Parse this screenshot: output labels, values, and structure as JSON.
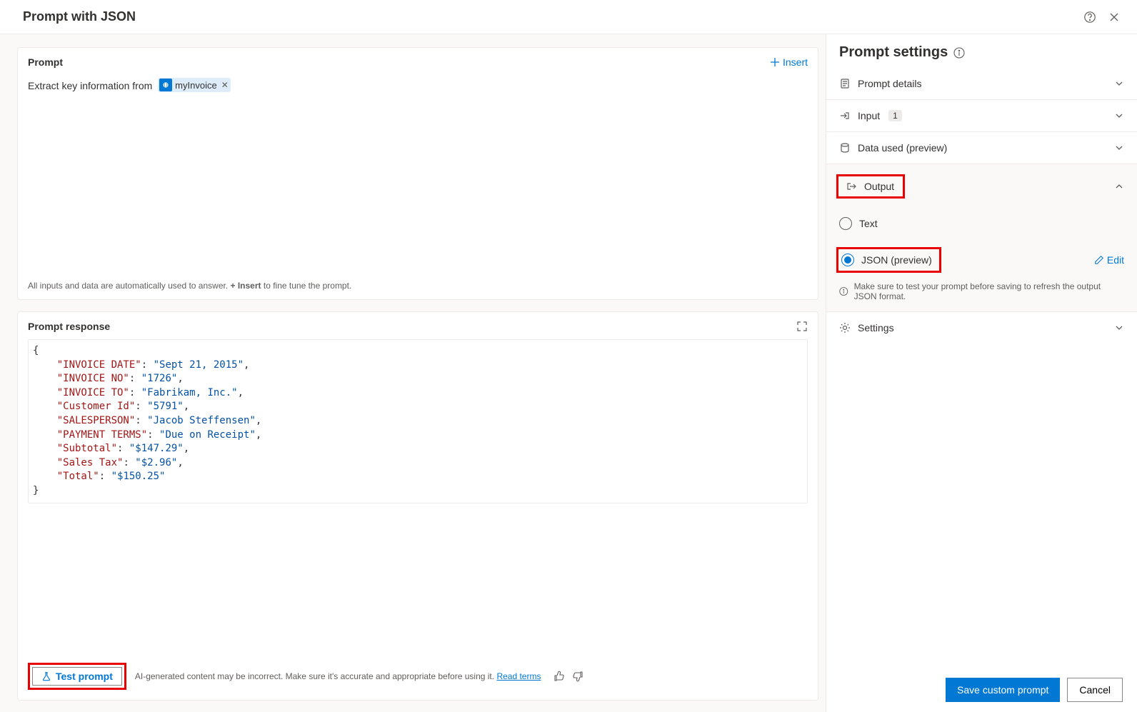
{
  "header": {
    "title": "Prompt with JSON"
  },
  "prompt": {
    "sectionTitle": "Prompt",
    "insertLabel": "Insert",
    "textPrefix": "Extract key information from",
    "chipLabel": "myInvoice",
    "hintPrefix": "All inputs and data are automatically used to answer. ",
    "hintBold": "+ Insert",
    "hintSuffix": " to fine tune the prompt."
  },
  "response": {
    "title": "Prompt response",
    "json": {
      "INVOICE DATE": "Sept 21, 2015",
      "INVOICE NO": "1726",
      "INVOICE TO": "Fabrikam, Inc.",
      "Customer Id": "5791",
      "SALESPERSON": "Jacob Steffensen",
      "PAYMENT TERMS": "Due on Receipt",
      "Subtotal": "$147.29",
      "Sales Tax": "$2.96",
      "Total": "$150.25"
    },
    "testLabel": "Test prompt",
    "aiNote": "AI-generated content may be incorrect. Make sure it's accurate and appropriate before using it. ",
    "readTerms": "Read terms"
  },
  "settings": {
    "title": "Prompt settings",
    "sections": {
      "promptDetails": "Prompt details",
      "input": "Input",
      "inputCount": "1",
      "dataUsed": "Data used (preview)",
      "output": "Output",
      "settings": "Settings"
    },
    "outputOptions": {
      "text": "Text",
      "json": "JSON (preview)",
      "edit": "Edit",
      "info": "Make sure to test your prompt before saving to refresh the output JSON format."
    }
  },
  "footer": {
    "save": "Save custom prompt",
    "cancel": "Cancel"
  }
}
